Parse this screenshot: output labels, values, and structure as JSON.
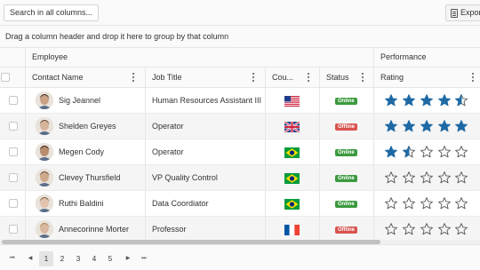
{
  "toolbar": {
    "search_label": "Search in all columns...",
    "export_label": "Export"
  },
  "group_panel": {
    "text": "Drag a column header and drop it here to group by that column"
  },
  "bands": {
    "employee": "Employee",
    "performance": "Performance"
  },
  "columns": {
    "contact_name": "Contact Name",
    "job_title": "Job Title",
    "country": "Cou...",
    "status": "Status",
    "rating": "Rating"
  },
  "rows": [
    {
      "name": "Sig Jeannel",
      "title": "Human Resources Assistant III",
      "country_flag": "us-flag",
      "status": "Online",
      "rating": 4.5
    },
    {
      "name": "Shelden Greyes",
      "title": "Operator",
      "country_flag": "uk-flag",
      "status": "Offline",
      "rating": 5
    },
    {
      "name": "Megen Cody",
      "title": "Operator",
      "country_flag": "brazil-flag",
      "status": "Online",
      "rating": 1.5
    },
    {
      "name": "Clevey Thursfield",
      "title": "VP Quality Control",
      "country_flag": "brazil-flag",
      "status": "Online",
      "rating": 0
    },
    {
      "name": "Ruthi Baldini",
      "title": "Data Coordiator",
      "country_flag": "brazil-flag",
      "status": "Online",
      "rating": 0
    },
    {
      "name": "Annecorinne Morter",
      "title": "Professor",
      "country_flag": "france-flag",
      "status": "Offline",
      "rating": 0
    }
  ],
  "pager": {
    "pages": [
      "1",
      "2",
      "3",
      "4",
      "5"
    ],
    "current": "1",
    "first_icon": "first-page-icon",
    "prev_icon": "prev-page-icon",
    "next_icon": "next-page-icon",
    "last_icon": "last-page-icon"
  },
  "colors": {
    "star": "#1f6aa5",
    "online": "#3b9a3e",
    "offline": "#d9534f"
  }
}
